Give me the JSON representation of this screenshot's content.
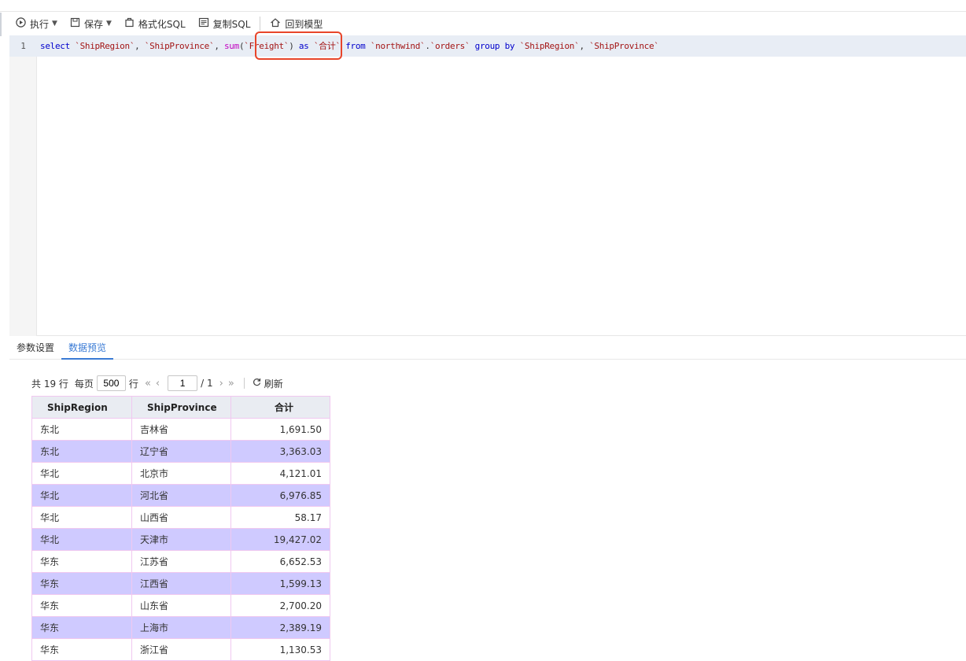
{
  "toolbar": {
    "run": "执行",
    "save": "保存",
    "format": "格式化SQL",
    "copy": "复制SQL",
    "back": "回到模型"
  },
  "editor": {
    "line_number": "1",
    "tokens": {
      "select": "select",
      "col1": "`ShipRegion`",
      "comma": ",",
      "col2": "`ShipProvince`",
      "sum": "sum",
      "lparen": "(",
      "freight": "`Freight`",
      "rparen": ")",
      "as": "as",
      "alias": "`合计`",
      "from": "from",
      "db": "`northwind`",
      "dot": ".",
      "tbl": "`orders`",
      "group": "group",
      "by": "by",
      "gcol1": "`ShipRegion`",
      "gcol2": "`ShipProvince`"
    }
  },
  "tabs": {
    "params": "参数设置",
    "preview": "数据预览"
  },
  "pager": {
    "total": "共 19 行",
    "per_page_label": "每页",
    "per_page_value": "500",
    "rows_suffix": "行",
    "first": "«",
    "prev": "‹",
    "current_page": "1",
    "page_total": "/ 1",
    "next": "›",
    "last": "»",
    "refresh": "刷新"
  },
  "table": {
    "columns": [
      "ShipRegion",
      "ShipProvince",
      "合计"
    ],
    "rows": [
      [
        "东北",
        "吉林省",
        "1,691.50"
      ],
      [
        "东北",
        "辽宁省",
        "3,363.03"
      ],
      [
        "华北",
        "北京市",
        "4,121.01"
      ],
      [
        "华北",
        "河北省",
        "6,976.85"
      ],
      [
        "华北",
        "山西省",
        "58.17"
      ],
      [
        "华北",
        "天津市",
        "19,427.02"
      ],
      [
        "华东",
        "江苏省",
        "6,652.53"
      ],
      [
        "华东",
        "江西省",
        "1,599.13"
      ],
      [
        "华东",
        "山东省",
        "2,700.20"
      ],
      [
        "华东",
        "上海市",
        "2,389.19"
      ],
      [
        "华东",
        "浙江省",
        "1,130.53"
      ]
    ]
  },
  "colors": {
    "accent": "#3a7bd5",
    "highlight": "#e8452a",
    "alt_row": "#cfcaff"
  }
}
